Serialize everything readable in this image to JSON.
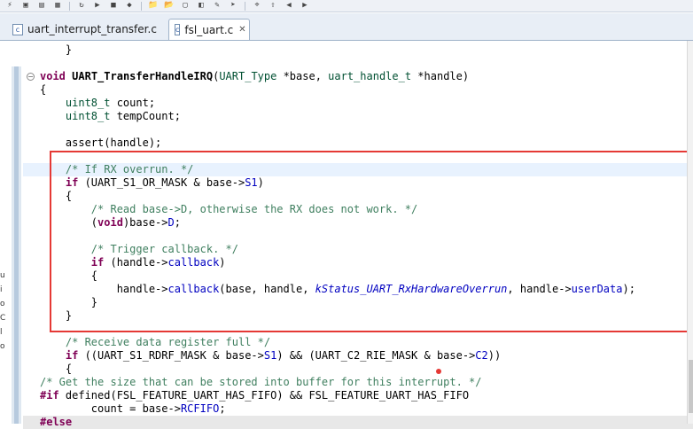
{
  "toolbar": {
    "buttons": [
      "debug-icon",
      "new-icon",
      "save-icon",
      "build-icon",
      "refresh-icon",
      "run-icon",
      "stop-icon",
      "external-tools-icon",
      "folder-icon",
      "open-icon",
      "file-icon",
      "toggle-icon",
      "highlight-icon",
      "forward-icon",
      "tag-icon",
      "up-icon",
      "back-icon",
      "next-icon"
    ],
    "glyphs": [
      "⚡",
      "▣",
      "▤",
      "▦",
      "↻",
      "▶",
      "■",
      "◆",
      "📁",
      "📂",
      "▢",
      "◧",
      "✎",
      "➤",
      "⌖",
      "⇧",
      "◀",
      "▶"
    ]
  },
  "tabs": [
    {
      "label": "uart_interrupt_transfer.c",
      "active": false
    },
    {
      "label": "fsl_uart.c",
      "active": true,
      "close": "✕"
    }
  ],
  "editor": {
    "lines": [
      [
        {
          "t": "    }"
        }
      ],
      [
        {
          "t": ""
        }
      ],
      [
        {
          "t": "void",
          "c": "kw"
        },
        {
          "t": " "
        },
        {
          "t": "UART_TransferHandleIRQ",
          "c": "fn"
        },
        {
          "t": "("
        },
        {
          "t": "UART_Type",
          "c": "ty"
        },
        {
          "t": " *base, "
        },
        {
          "t": "uart_handle_t",
          "c": "ty"
        },
        {
          "t": " *handle)"
        }
      ],
      [
        {
          "t": "{"
        }
      ],
      [
        {
          "t": "    "
        },
        {
          "t": "uint8_t",
          "c": "ty"
        },
        {
          "t": " count;"
        }
      ],
      [
        {
          "t": "    "
        },
        {
          "t": "uint8_t",
          "c": "ty"
        },
        {
          "t": " tempCount;"
        }
      ],
      [
        {
          "t": ""
        }
      ],
      [
        {
          "t": "    assert(handle);"
        }
      ],
      [
        {
          "t": ""
        }
      ],
      [
        {
          "t": "    "
        },
        {
          "t": "/* If RX overrun. */",
          "c": "cm"
        }
      ],
      [
        {
          "t": "    "
        },
        {
          "t": "if",
          "c": "kw"
        },
        {
          "t": " (UART_S1_OR_MASK & base->"
        },
        {
          "t": "S1",
          "c": "fld"
        },
        {
          "t": ")"
        }
      ],
      [
        {
          "t": "    {"
        }
      ],
      [
        {
          "t": "        "
        },
        {
          "t": "/* Read base->D, otherwise the RX does not work. */",
          "c": "cm"
        }
      ],
      [
        {
          "t": "        ("
        },
        {
          "t": "void",
          "c": "kw"
        },
        {
          "t": ")base->"
        },
        {
          "t": "D",
          "c": "fld"
        },
        {
          "t": ";"
        }
      ],
      [
        {
          "t": ""
        }
      ],
      [
        {
          "t": "        "
        },
        {
          "t": "/* Trigger callback. */",
          "c": "cm"
        }
      ],
      [
        {
          "t": "        "
        },
        {
          "t": "if",
          "c": "kw"
        },
        {
          "t": " (handle->"
        },
        {
          "t": "callback",
          "c": "fld"
        },
        {
          "t": ")"
        }
      ],
      [
        {
          "t": "        {"
        }
      ],
      [
        {
          "t": "            handle->"
        },
        {
          "t": "callback",
          "c": "fld"
        },
        {
          "t": "(base, handle, "
        },
        {
          "t": "kStatus_UART_RxHardwareOverrun",
          "c": "en"
        },
        {
          "t": ", handle->"
        },
        {
          "t": "userData",
          "c": "fld"
        },
        {
          "t": ");"
        }
      ],
      [
        {
          "t": "        }"
        }
      ],
      [
        {
          "t": "    }"
        }
      ],
      [
        {
          "t": ""
        }
      ],
      [
        {
          "t": "    "
        },
        {
          "t": "/* Receive data register full */",
          "c": "cm"
        }
      ],
      [
        {
          "t": "    "
        },
        {
          "t": "if",
          "c": "kw"
        },
        {
          "t": " ((UART_S1_RDRF_MASK & base->"
        },
        {
          "t": "S1",
          "c": "fld"
        },
        {
          "t": ") && (UART_C2_RIE_MASK & base->"
        },
        {
          "t": "C2",
          "c": "fld"
        },
        {
          "t": "))"
        }
      ],
      [
        {
          "t": "    {"
        }
      ],
      [
        {
          "t": "/* Get the size that can be stored into buffer for this interrupt. */",
          "c": "cm"
        }
      ],
      [
        {
          "t": "#if",
          "c": "kw"
        },
        {
          "t": " defined(FSL_FEATURE_UART_HAS_FIFO) && FSL_FEATURE_UART_HAS_FIFO"
        }
      ],
      [
        {
          "t": "        count = base->"
        },
        {
          "t": "RCFIFO",
          "c": "fld"
        },
        {
          "t": ";"
        }
      ],
      [
        {
          "t": "#else",
          "c": "kw"
        }
      ]
    ],
    "left_fragments": [
      "u",
      "i",
      "o",
      "C",
      "l",
      "o"
    ]
  }
}
